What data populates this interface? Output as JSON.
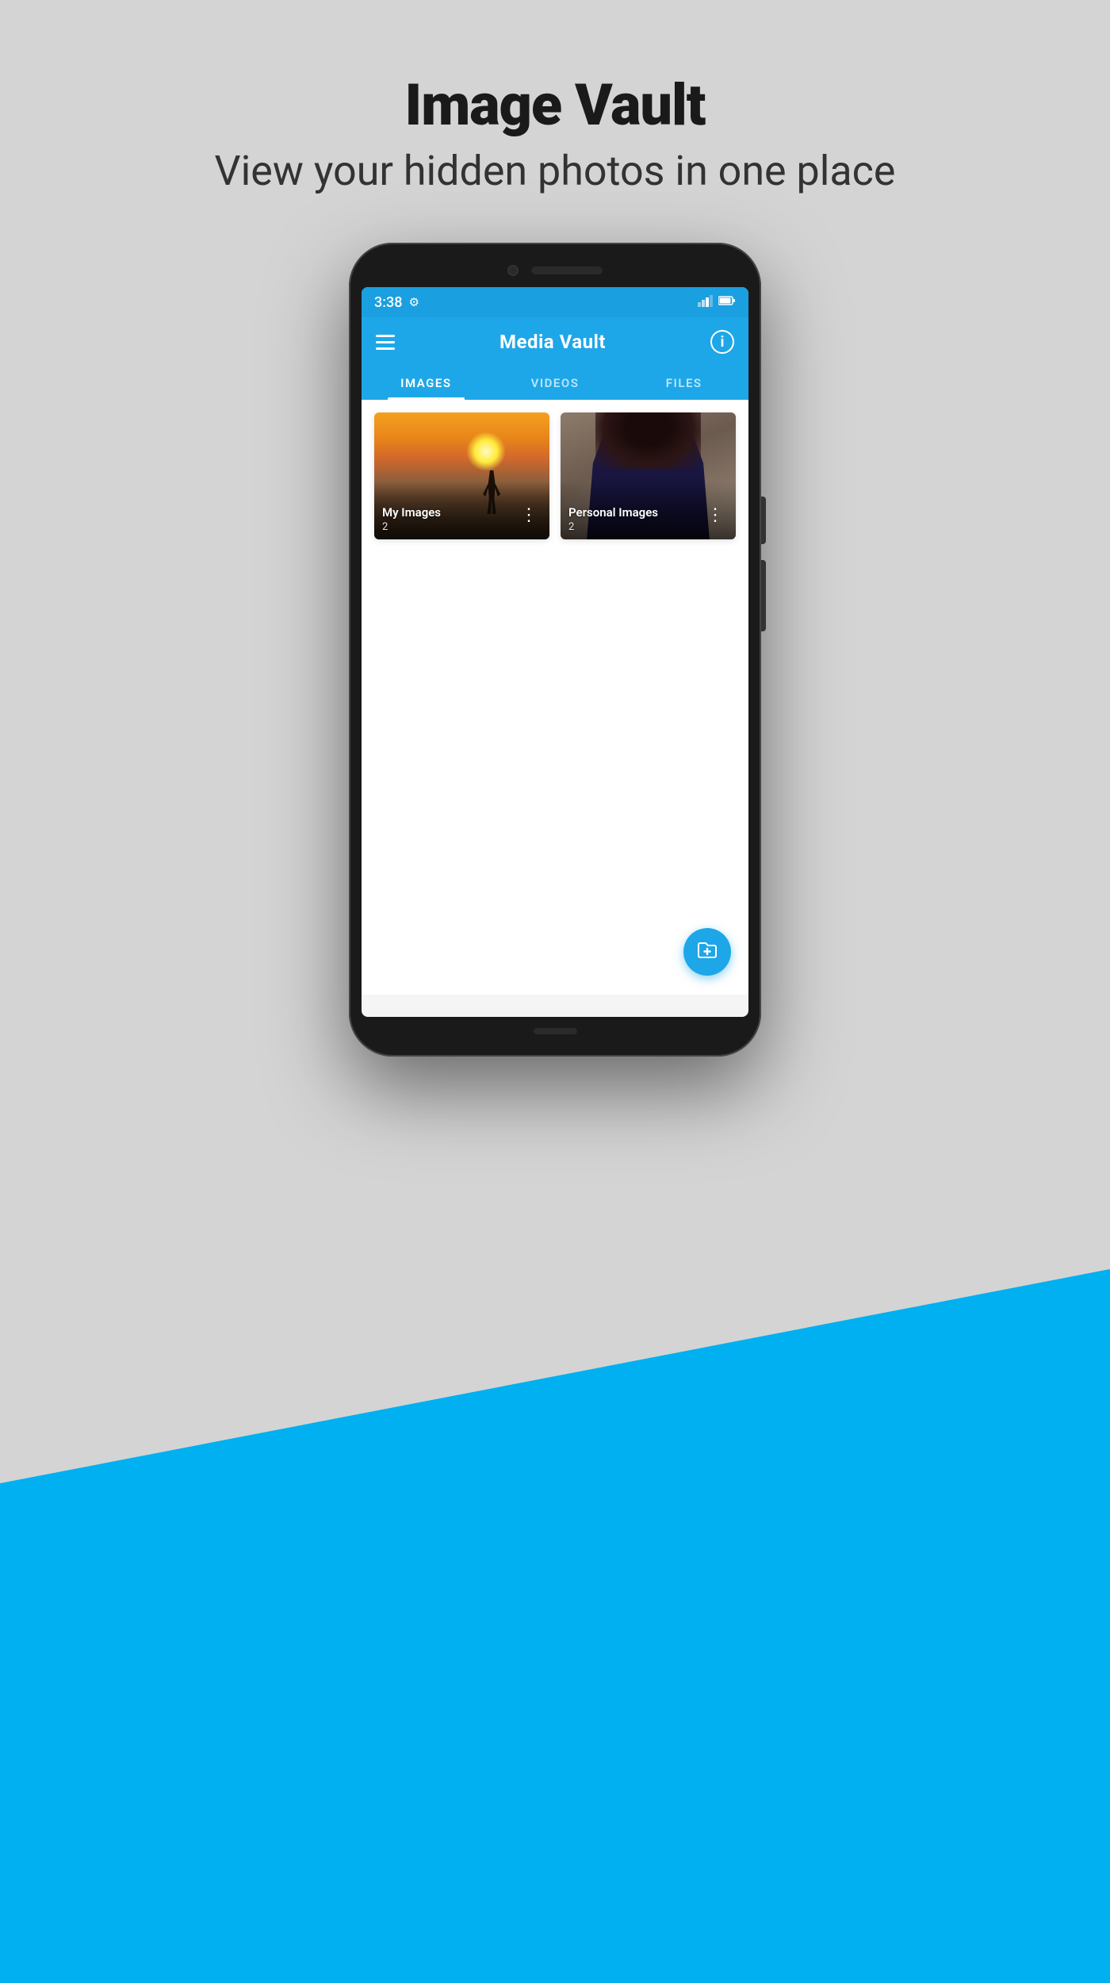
{
  "header": {
    "title": "Image Vault",
    "subtitle": "View your hidden photos in one place"
  },
  "status_bar": {
    "time": "3:38",
    "gear": "⚙"
  },
  "toolbar": {
    "app_name": "Media Vault",
    "info_label": "i"
  },
  "tabs": [
    {
      "label": "IMAGES",
      "active": true
    },
    {
      "label": "VIDEOS",
      "active": false
    },
    {
      "label": "FILES",
      "active": false
    }
  ],
  "folders": [
    {
      "name": "My Images",
      "count": "2",
      "thumb_type": "hiker"
    },
    {
      "name": "Personal Images",
      "count": "2",
      "thumb_type": "person"
    }
  ],
  "fab": {
    "label": "Add folder"
  },
  "colors": {
    "primary": "#1ea7e8",
    "background": "#d4d4d4",
    "blue_accent": "#00b0f0"
  }
}
